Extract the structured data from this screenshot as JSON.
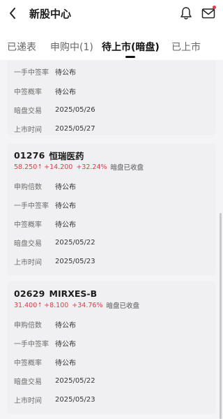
{
  "header": {
    "title": "新股中心",
    "back_icon": "chevron-left-icon",
    "bell_icon": "bell-icon",
    "mail_icon": "mail-icon",
    "notification_dot_color": "#e8384a"
  },
  "tabs": [
    {
      "label": "已递表",
      "active": false
    },
    {
      "label": "申购中(1)",
      "active": false
    },
    {
      "label": "待上市(暗盘)",
      "active": true
    },
    {
      "label": "已上市",
      "active": false
    }
  ],
  "partial_card": {
    "rows": [
      {
        "label": "一手中签率",
        "value": "待公布"
      },
      {
        "label": "中签概率",
        "value": "待公布"
      },
      {
        "label": "暗盘交易",
        "value": "2025/05/26"
      },
      {
        "label": "上市时间",
        "value": "2025/05/27"
      }
    ]
  },
  "stocks": [
    {
      "code": "01276",
      "name": "恒瑞医药",
      "price": "58.250",
      "change": "+14.200",
      "change_pct": "+32.24%",
      "status": "暗盘已收盘",
      "rows": [
        {
          "label": "申购倍数",
          "value": "待公布"
        },
        {
          "label": "一手中签率",
          "value": "待公布"
        },
        {
          "label": "中签概率",
          "value": "待公布"
        },
        {
          "label": "暗盘交易",
          "value": "2025/05/22"
        },
        {
          "label": "上市时间",
          "value": "2025/05/23"
        }
      ]
    },
    {
      "code": "02629",
      "name": "MIRXES-B",
      "price": "31.400",
      "change": "+8.100",
      "change_pct": "+34.76%",
      "status": "暗盘已收盘",
      "rows": [
        {
          "label": "申购倍数",
          "value": "待公布"
        },
        {
          "label": "一手中签率",
          "value": "待公布"
        },
        {
          "label": "中签概率",
          "value": "待公布"
        },
        {
          "label": "暗盘交易",
          "value": "2025/05/22"
        },
        {
          "label": "上市时间",
          "value": "2025/05/23"
        }
      ]
    }
  ],
  "colors": {
    "up": "#e8384a",
    "card_bg": "#f0f0f2"
  }
}
